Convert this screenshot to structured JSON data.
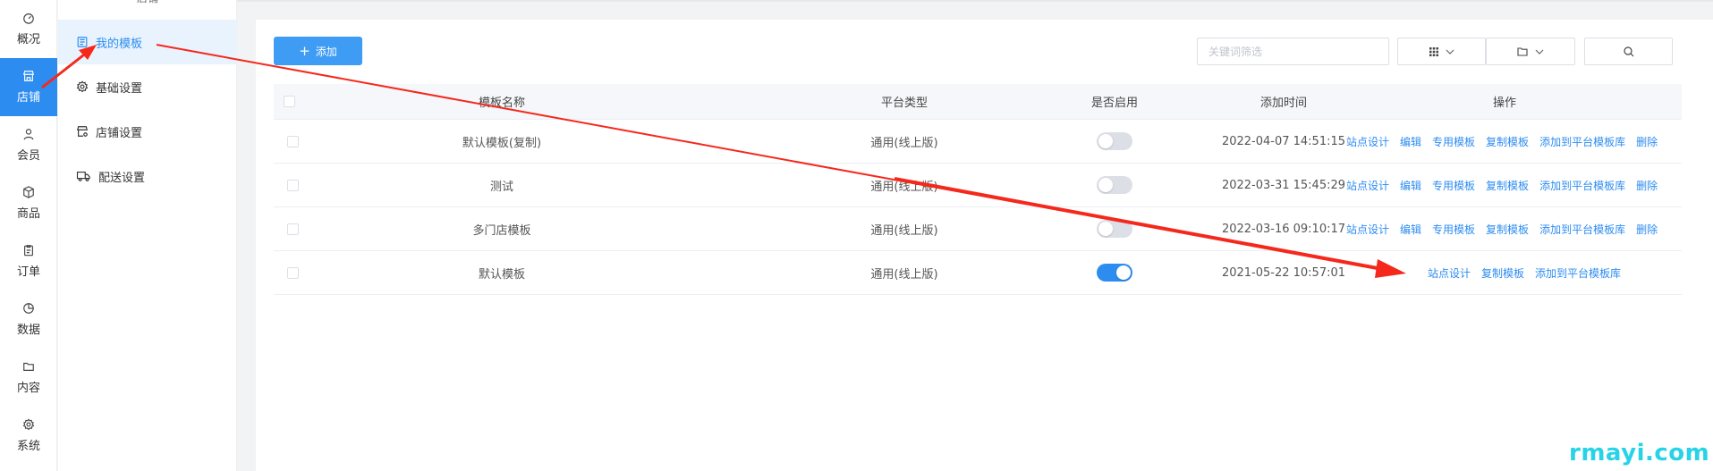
{
  "rail": {
    "items": [
      {
        "label": "概况",
        "icon": "dashboard-icon",
        "active": false
      },
      {
        "label": "店铺",
        "icon": "store-icon",
        "active": true
      },
      {
        "label": "会员",
        "icon": "user-icon",
        "active": false
      },
      {
        "label": "商品",
        "icon": "box-icon",
        "active": false
      },
      {
        "label": "订单",
        "icon": "clipboard-icon",
        "active": false
      },
      {
        "label": "数据",
        "icon": "pie-chart-icon",
        "active": false
      },
      {
        "label": "内容",
        "icon": "folder-icon",
        "active": false
      },
      {
        "label": "系统",
        "icon": "gear-icon",
        "active": false
      }
    ]
  },
  "submenu": {
    "header": "店铺",
    "items": [
      {
        "label": "我的模板",
        "icon": "template-icon",
        "active": true
      },
      {
        "label": "基础设置",
        "icon": "gear-icon",
        "active": false
      },
      {
        "label": "店铺设置",
        "icon": "store-settings-icon",
        "active": false
      },
      {
        "label": "配送设置",
        "icon": "truck-icon",
        "active": false
      }
    ]
  },
  "toolbar": {
    "add_label": "添加",
    "search_placeholder": "关键词筛选"
  },
  "table": {
    "headers": {
      "name": "模板名称",
      "platform": "平台类型",
      "enabled": "是否启用",
      "time": "添加时间",
      "ops": "操作"
    },
    "rows": [
      {
        "name": "默认模板(复制)",
        "platform": "通用(线上版)",
        "enabled": false,
        "time": "2022-04-07 14:51:15",
        "ops": [
          "站点设计",
          "编辑",
          "专用模板",
          "复制模板",
          "添加到平台模板库",
          "删除"
        ]
      },
      {
        "name": "测试",
        "platform": "通用(线上版)",
        "enabled": false,
        "time": "2022-03-31 15:45:29",
        "ops": [
          "站点设计",
          "编辑",
          "专用模板",
          "复制模板",
          "添加到平台模板库",
          "删除"
        ]
      },
      {
        "name": "多门店模板",
        "platform": "通用(线上版)",
        "enabled": false,
        "time": "2022-03-16 09:10:17",
        "ops": [
          "站点设计",
          "编辑",
          "专用模板",
          "复制模板",
          "添加到平台模板库",
          "删除"
        ]
      },
      {
        "name": "默认模板",
        "platform": "通用(线上版)",
        "enabled": true,
        "time": "2021-05-22 10:57:01",
        "ops": [
          "站点设计",
          "复制模板",
          "添加到平台模板库"
        ]
      }
    ]
  },
  "colors": {
    "accent": "#2d8cf0",
    "annotation": "#f5281c",
    "watermark": "#27d3e6"
  },
  "watermark": "rmayi.com"
}
